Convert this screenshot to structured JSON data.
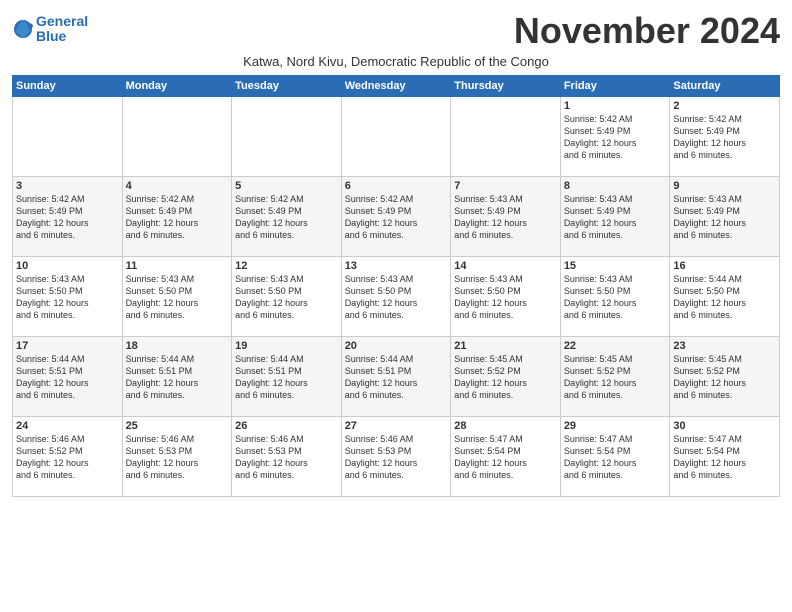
{
  "logo": {
    "line1": "General",
    "line2": "Blue"
  },
  "title": "November 2024",
  "subtitle": "Katwa, Nord Kivu, Democratic Republic of the Congo",
  "days_of_week": [
    "Sunday",
    "Monday",
    "Tuesday",
    "Wednesday",
    "Thursday",
    "Friday",
    "Saturday"
  ],
  "weeks": [
    [
      {
        "day": "",
        "info": ""
      },
      {
        "day": "",
        "info": ""
      },
      {
        "day": "",
        "info": ""
      },
      {
        "day": "",
        "info": ""
      },
      {
        "day": "",
        "info": ""
      },
      {
        "day": "1",
        "info": "Sunrise: 5:42 AM\nSunset: 5:49 PM\nDaylight: 12 hours\nand 6 minutes."
      },
      {
        "day": "2",
        "info": "Sunrise: 5:42 AM\nSunset: 5:49 PM\nDaylight: 12 hours\nand 6 minutes."
      }
    ],
    [
      {
        "day": "3",
        "info": "Sunrise: 5:42 AM\nSunset: 5:49 PM\nDaylight: 12 hours\nand 6 minutes."
      },
      {
        "day": "4",
        "info": "Sunrise: 5:42 AM\nSunset: 5:49 PM\nDaylight: 12 hours\nand 6 minutes."
      },
      {
        "day": "5",
        "info": "Sunrise: 5:42 AM\nSunset: 5:49 PM\nDaylight: 12 hours\nand 6 minutes."
      },
      {
        "day": "6",
        "info": "Sunrise: 5:42 AM\nSunset: 5:49 PM\nDaylight: 12 hours\nand 6 minutes."
      },
      {
        "day": "7",
        "info": "Sunrise: 5:43 AM\nSunset: 5:49 PM\nDaylight: 12 hours\nand 6 minutes."
      },
      {
        "day": "8",
        "info": "Sunrise: 5:43 AM\nSunset: 5:49 PM\nDaylight: 12 hours\nand 6 minutes."
      },
      {
        "day": "9",
        "info": "Sunrise: 5:43 AM\nSunset: 5:49 PM\nDaylight: 12 hours\nand 6 minutes."
      }
    ],
    [
      {
        "day": "10",
        "info": "Sunrise: 5:43 AM\nSunset: 5:50 PM\nDaylight: 12 hours\nand 6 minutes."
      },
      {
        "day": "11",
        "info": "Sunrise: 5:43 AM\nSunset: 5:50 PM\nDaylight: 12 hours\nand 6 minutes."
      },
      {
        "day": "12",
        "info": "Sunrise: 5:43 AM\nSunset: 5:50 PM\nDaylight: 12 hours\nand 6 minutes."
      },
      {
        "day": "13",
        "info": "Sunrise: 5:43 AM\nSunset: 5:50 PM\nDaylight: 12 hours\nand 6 minutes."
      },
      {
        "day": "14",
        "info": "Sunrise: 5:43 AM\nSunset: 5:50 PM\nDaylight: 12 hours\nand 6 minutes."
      },
      {
        "day": "15",
        "info": "Sunrise: 5:43 AM\nSunset: 5:50 PM\nDaylight: 12 hours\nand 6 minutes."
      },
      {
        "day": "16",
        "info": "Sunrise: 5:44 AM\nSunset: 5:50 PM\nDaylight: 12 hours\nand 6 minutes."
      }
    ],
    [
      {
        "day": "17",
        "info": "Sunrise: 5:44 AM\nSunset: 5:51 PM\nDaylight: 12 hours\nand 6 minutes."
      },
      {
        "day": "18",
        "info": "Sunrise: 5:44 AM\nSunset: 5:51 PM\nDaylight: 12 hours\nand 6 minutes."
      },
      {
        "day": "19",
        "info": "Sunrise: 5:44 AM\nSunset: 5:51 PM\nDaylight: 12 hours\nand 6 minutes."
      },
      {
        "day": "20",
        "info": "Sunrise: 5:44 AM\nSunset: 5:51 PM\nDaylight: 12 hours\nand 6 minutes."
      },
      {
        "day": "21",
        "info": "Sunrise: 5:45 AM\nSunset: 5:52 PM\nDaylight: 12 hours\nand 6 minutes."
      },
      {
        "day": "22",
        "info": "Sunrise: 5:45 AM\nSunset: 5:52 PM\nDaylight: 12 hours\nand 6 minutes."
      },
      {
        "day": "23",
        "info": "Sunrise: 5:45 AM\nSunset: 5:52 PM\nDaylight: 12 hours\nand 6 minutes."
      }
    ],
    [
      {
        "day": "24",
        "info": "Sunrise: 5:46 AM\nSunset: 5:52 PM\nDaylight: 12 hours\nand 6 minutes."
      },
      {
        "day": "25",
        "info": "Sunrise: 5:46 AM\nSunset: 5:53 PM\nDaylight: 12 hours\nand 6 minutes."
      },
      {
        "day": "26",
        "info": "Sunrise: 5:46 AM\nSunset: 5:53 PM\nDaylight: 12 hours\nand 6 minutes."
      },
      {
        "day": "27",
        "info": "Sunrise: 5:46 AM\nSunset: 5:53 PM\nDaylight: 12 hours\nand 6 minutes."
      },
      {
        "day": "28",
        "info": "Sunrise: 5:47 AM\nSunset: 5:54 PM\nDaylight: 12 hours\nand 6 minutes."
      },
      {
        "day": "29",
        "info": "Sunrise: 5:47 AM\nSunset: 5:54 PM\nDaylight: 12 hours\nand 6 minutes."
      },
      {
        "day": "30",
        "info": "Sunrise: 5:47 AM\nSunset: 5:54 PM\nDaylight: 12 hours\nand 6 minutes."
      }
    ]
  ]
}
